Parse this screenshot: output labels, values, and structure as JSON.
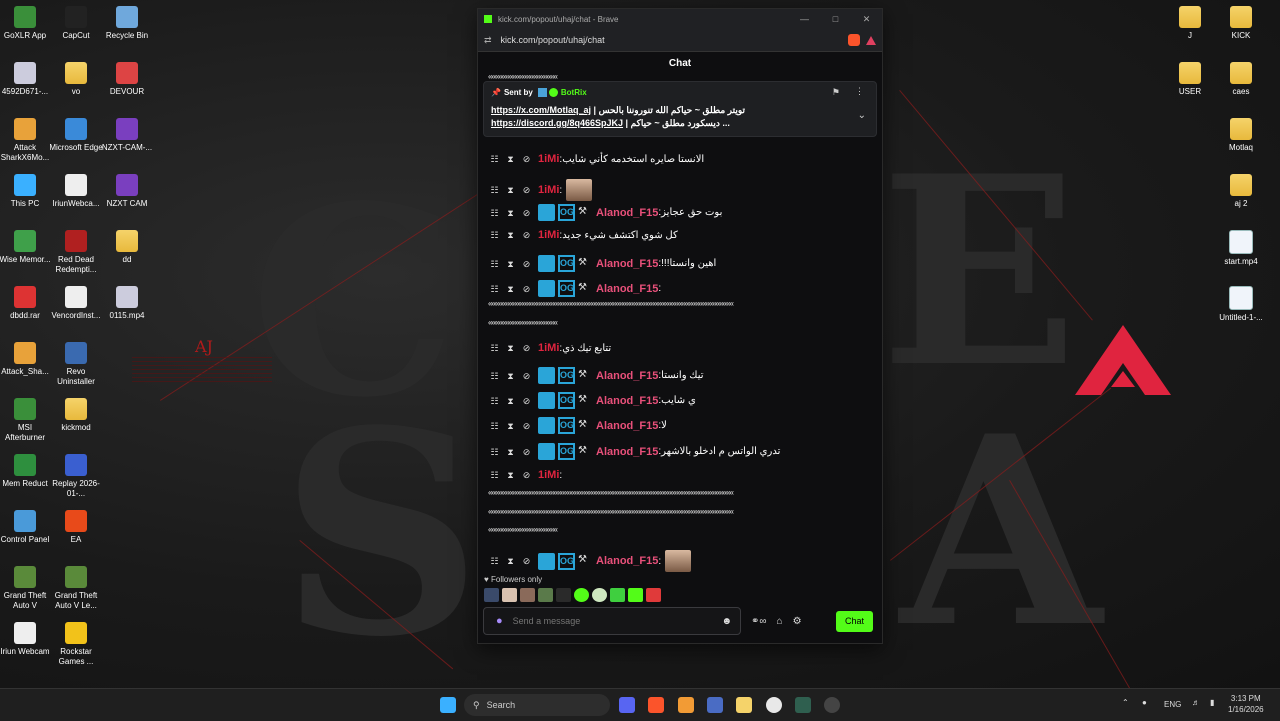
{
  "browser": {
    "window_title": "kick.com/popout/uhaj/chat - Brave",
    "url": "kick.com/popout/uhaj/chat"
  },
  "chat": {
    "header": "Chat",
    "pinned": {
      "sent_by": "Sent by",
      "bot_name": "BotRix",
      "line1_link": "https://x.com/Motlaq_aj",
      "line1_text": "| تويتر مطلق ~ حياكم الله تنوروننا بالحس",
      "line2_link": "https://discord.gg/8q466SpJKJ",
      "line2_text": "| ديسكورد مطلق ~ حياكم ..."
    },
    "messages": [
      {
        "user": "1iMi",
        "text": "الانستا صايره استخدمه كأني شايب"
      },
      {
        "user": "1iMi",
        "text": ""
      },
      {
        "user": "Alanod_F15",
        "text": "بوت حق عجايز"
      },
      {
        "user": "1iMi",
        "text": "كل شوي اكتشف شيء جديد"
      },
      {
        "user": "Alanod_F15",
        "text": "!!!اهين وانستا"
      },
      {
        "user": "Alanod_F15",
        "text": ""
      },
      {
        "user": "1iMi",
        "text": "تتابع تيك ذي"
      },
      {
        "user": "Alanod_F15",
        "text": "تيك وانستا"
      },
      {
        "user": "Alanod_F15",
        "text": "ي شايب"
      },
      {
        "user": "Alanod_F15",
        "text": "لا"
      },
      {
        "user": "Alanod_F15",
        "text": "تدري الواتس م ادخلو بالاشهر"
      },
      {
        "user": "1iMi",
        "text": ""
      },
      {
        "user": "Alanod_F15",
        "text": ""
      }
    ],
    "spam_line_long": "«««««««««««««««««««««««««««««««««««««««««««««««««««««««««««««««««««««««",
    "spam_line_short": "««««««««««««««««««««",
    "followers_only": "Followers only",
    "input_placeholder": "Send a message",
    "send_label": "Chat"
  },
  "desktop_icons_left": [
    {
      "label": "GoXLR App"
    },
    {
      "label": "CapCut"
    },
    {
      "label": "Recycle Bin"
    },
    {
      "label": "4592D671-..."
    },
    {
      "label": "vo"
    },
    {
      "label": "DEVOUR"
    },
    {
      "label": "Attack SharkX6Mo..."
    },
    {
      "label": "Microsoft Edge"
    },
    {
      "label": "NZXT-CAM-..."
    },
    {
      "label": "This PC"
    },
    {
      "label": "IriunWebca..."
    },
    {
      "label": "NZXT CAM"
    },
    {
      "label": "Wise Memor..."
    },
    {
      "label": "Red Dead Redempti..."
    },
    {
      "label": "dd"
    },
    {
      "label": "dbdd.rar"
    },
    {
      "label": "VencordInst..."
    },
    {
      "label": "0115.mp4"
    },
    {
      "label": "Attack_Sha..."
    },
    {
      "label": "Revo Uninstaller"
    },
    {
      "label": "MSI Afterburner"
    },
    {
      "label": "kickmod"
    },
    {
      "label": "Mem Reduct"
    },
    {
      "label": "Replay 2026-01-..."
    },
    {
      "label": "Control Panel"
    },
    {
      "label": "EA"
    },
    {
      "label": "Grand Theft Auto V"
    },
    {
      "label": "Grand Theft Auto V Le..."
    },
    {
      "label": "Iriun Webcam"
    },
    {
      "label": "Rockstar Games ..."
    }
  ],
  "desktop_icons_right": [
    {
      "label": "J"
    },
    {
      "label": "KICK"
    },
    {
      "label": "USER"
    },
    {
      "label": "caes"
    },
    {
      "label": "Motlaq"
    },
    {
      "label": "aj 2"
    },
    {
      "label": "start.mp4"
    },
    {
      "label": "Untitled-1-..."
    }
  ],
  "desktop_logo": "AJ",
  "taskbar": {
    "search_label": "Search",
    "language": "ENG",
    "time": "3:13 PM",
    "date": "1/16/2026"
  }
}
